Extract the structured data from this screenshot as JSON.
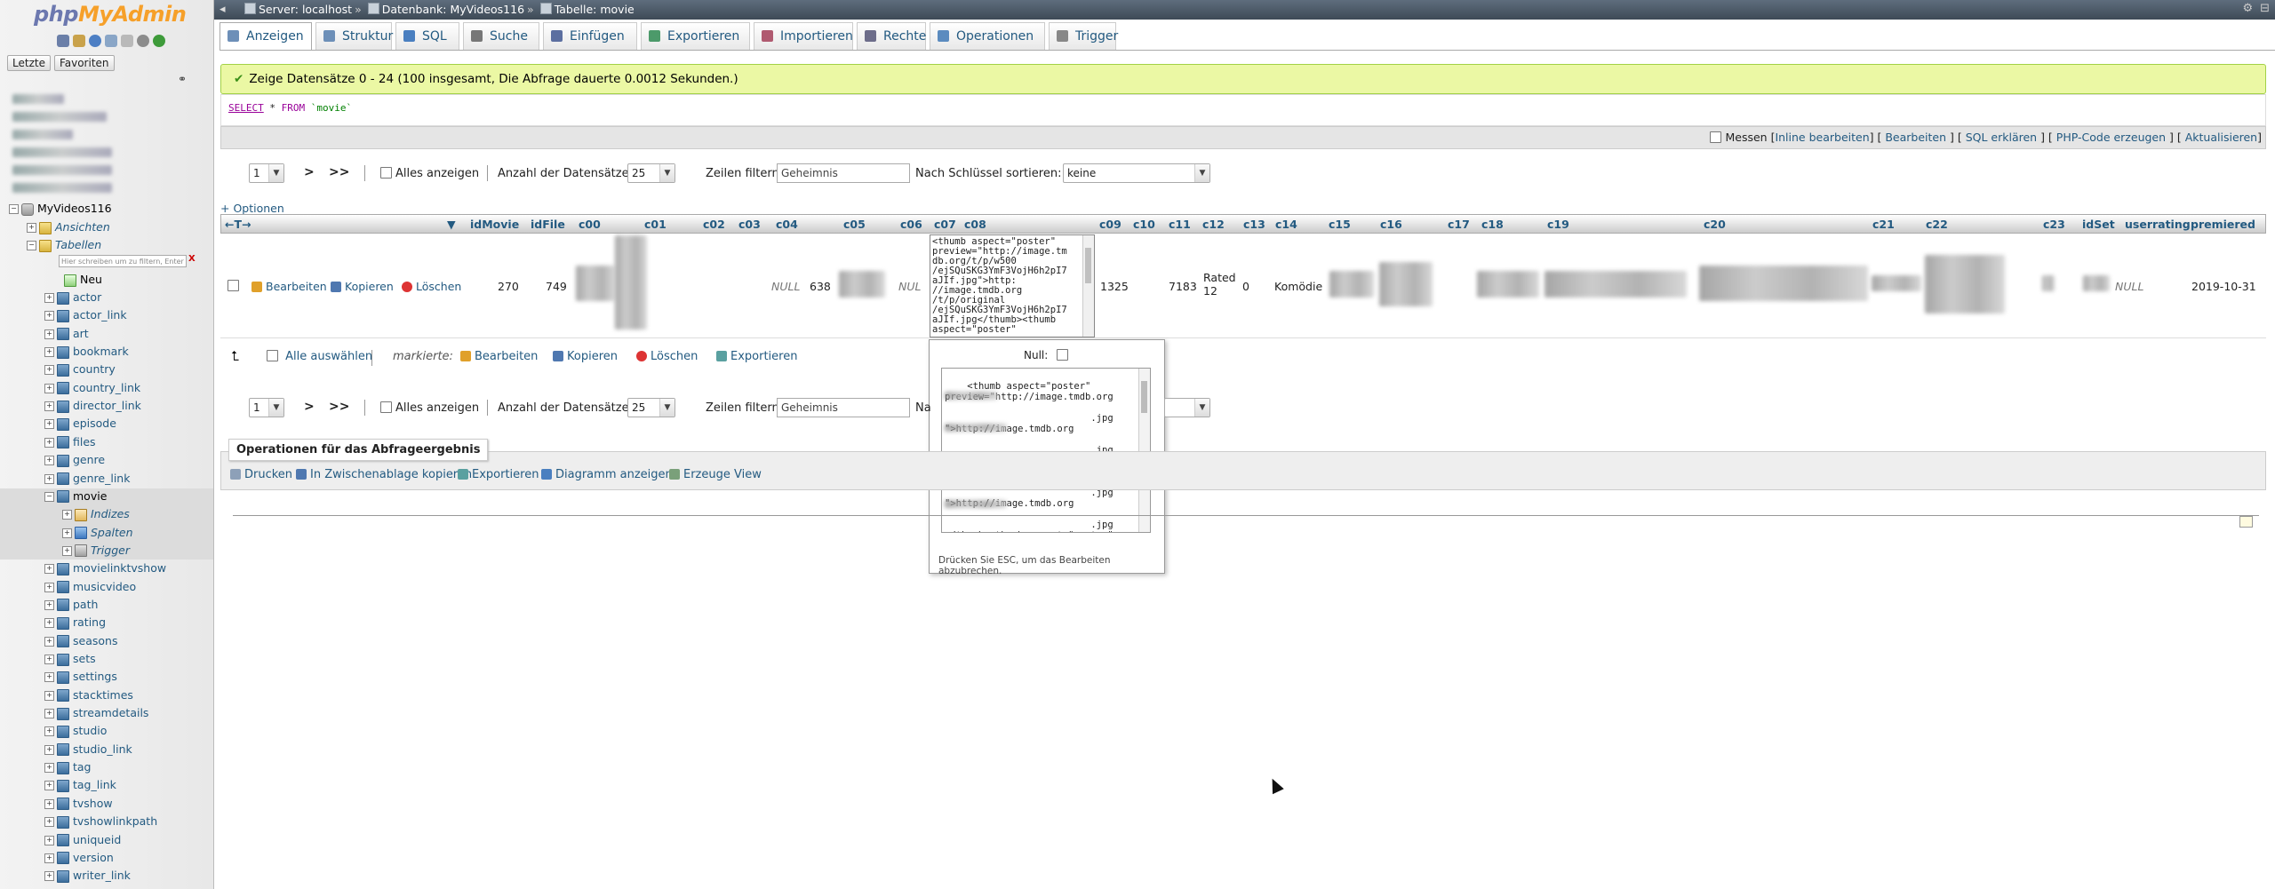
{
  "nav": {
    "logo_php": "php",
    "logo_myadmin": "MyAdmin",
    "tabs": [
      "Letzte",
      "Favoriten"
    ],
    "collapse": "⚭",
    "database": "MyVideos116",
    "views_label": "Ansichten",
    "tables_label": "Tabellen",
    "filter_placeholder": "Hier schreiben um zu filtern, Enter",
    "filter_clear": "X",
    "new_label": "Neu",
    "tables": [
      "actor",
      "actor_link",
      "art",
      "bookmark",
      "country",
      "country_link",
      "director_link",
      "episode",
      "files",
      "genre",
      "genre_link",
      "movie"
    ],
    "movie_children": [
      "Indizes",
      "Spalten",
      "Trigger"
    ],
    "tables_after": [
      "movielinktvshow",
      "musicvideo",
      "path",
      "rating",
      "seasons",
      "sets",
      "settings",
      "stacktimes",
      "streamdetails",
      "studio",
      "studio_link",
      "tag",
      "tag_link",
      "tvshow",
      "tvshowlinkpath",
      "uniqueid",
      "version",
      "writer_link"
    ]
  },
  "breadcrumb": {
    "server": "Server: localhost",
    "database": "Datenbank: MyVideos116",
    "table": "Tabelle: movie"
  },
  "menu": {
    "tabs": [
      "Anzeigen",
      "Struktur",
      "SQL",
      "Suche",
      "Einfügen",
      "Exportieren",
      "Importieren",
      "Rechte",
      "Operationen",
      "Trigger"
    ]
  },
  "message": {
    "success": "Zeige Datensätze 0 - 24 (100 insgesamt, Die Abfrage dauerte 0.0012 Sekunden.)"
  },
  "sql": {
    "select": "SELECT",
    "star": "*",
    "from": "FROM",
    "table": "`movie`"
  },
  "sql_options": {
    "measure": "Messen",
    "inline_edit": "Inline bearbeiten",
    "edit": "Bearbeiten",
    "explain": "SQL erklären",
    "php_code": "PHP-Code erzeugen",
    "refresh": "Aktualisieren"
  },
  "navigation": {
    "page": "1",
    "next": ">",
    "last": ">>",
    "show_all": "Alles anzeigen",
    "rows_label": "Anzahl der Datensätze:",
    "rows_value": "25",
    "filter_label": "Zeilen filtern:",
    "filter_value": "Geheimnis",
    "sort_label": "Nach Schlüssel sortieren:",
    "sort_value": "keine",
    "sort_label_partial": "Na"
  },
  "table": {
    "options_link": "+ Optionen",
    "nav_arrows": "←T→",
    "columns": [
      "idMovie",
      "idFile",
      "c00",
      "c01",
      "c02",
      "c03",
      "c04",
      "c05",
      "c06",
      "c07",
      "c08",
      "c09",
      "c10",
      "c11",
      "c12",
      "c13",
      "c14",
      "c15",
      "c16",
      "c17",
      "c18",
      "c19",
      "c20",
      "c21",
      "c22",
      "c23",
      "idSet",
      "userrating",
      "premiered"
    ],
    "row": {
      "edit": "Bearbeiten",
      "copy": "Kopieren",
      "delete": "Löschen",
      "idMovie": "270",
      "idFile": "749",
      "c04": "NULL",
      "c05": "638",
      "c07": "NUL",
      "c09": "1325",
      "c11": "7183",
      "c12": "Rated 12",
      "c13": "0",
      "c14": "Komödie",
      "userrating": "NULL",
      "premiered": "2019-10-31"
    },
    "c08_text": "<thumb aspect=\"poster\"\npreview=\"http://image.tm\ndb.org/t/p/w500\n/ejSQuSKG3YmF3VojH6h2pI7\naJIf.jpg\">http:\n//image.tmdb.org\n/t/p/original\n/ejSQuSKG3YmF3VojH6h2pI7\naJIf.jpg</thumb><thumb\naspect=\"poster\""
  },
  "edit_popup": {
    "null_label": "Null:",
    "text": "<thumb aspect=\"poster\"\npreview=\"http://image.tmdb.org\n\n                          .jpg\n\">http://image.tmdb.org\n\n                          .jpg\n</thumb><thumb aspect=\"poster\"\npreview=\"http://image.tmdb.org\n\n                          .jpg\n\">http://image.tmdb.org\n\n                          .jpg\n</thumb><thumb aspect=\"poster\"\npreview=\"http://image.tmdb.org",
    "hint": "Drücken Sie ESC, um das Bearbeiten abzubrechen."
  },
  "bulk": {
    "select_all": "Alle auswählen",
    "marked": "markierte:",
    "edit": "Bearbeiten",
    "copy": "Kopieren",
    "delete": "Löschen",
    "export": "Exportieren"
  },
  "query_ops": {
    "legend": "Operationen für das Abfrageergebnis",
    "print": "Drucken",
    "clipboard": "In Zwischenablage kopieren",
    "export": "Exportieren",
    "chart": "Diagramm anzeigen",
    "view": "Erzeuge View"
  },
  "colors": {
    "link": "#235a81",
    "success_bg": "#ebf8a4",
    "topbar": "#4a5866"
  }
}
